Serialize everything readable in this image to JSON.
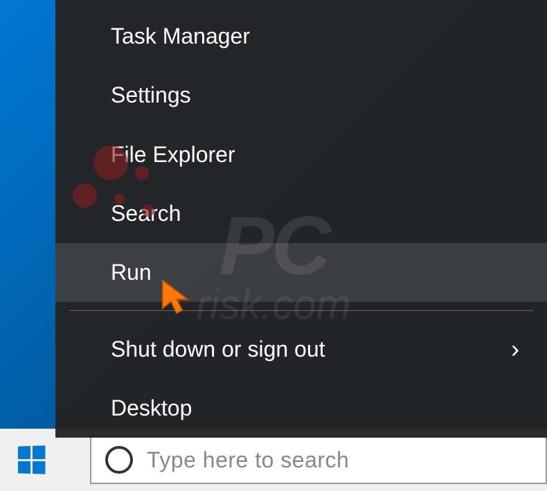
{
  "menu": {
    "items": [
      {
        "label": "Task Manager",
        "highlighted": false,
        "hasSubmenu": false
      },
      {
        "label": "Settings",
        "highlighted": false,
        "hasSubmenu": false
      },
      {
        "label": "File Explorer",
        "highlighted": false,
        "hasSubmenu": false
      },
      {
        "label": "Search",
        "highlighted": false,
        "hasSubmenu": false
      },
      {
        "label": "Run",
        "highlighted": true,
        "hasSubmenu": false
      },
      {
        "label": "Shut down or sign out",
        "highlighted": false,
        "hasSubmenu": true
      },
      {
        "label": "Desktop",
        "highlighted": false,
        "hasSubmenu": false
      }
    ]
  },
  "search": {
    "placeholder": "Type here to search"
  },
  "watermark": {
    "main": "PC",
    "sub": "risk.com"
  }
}
